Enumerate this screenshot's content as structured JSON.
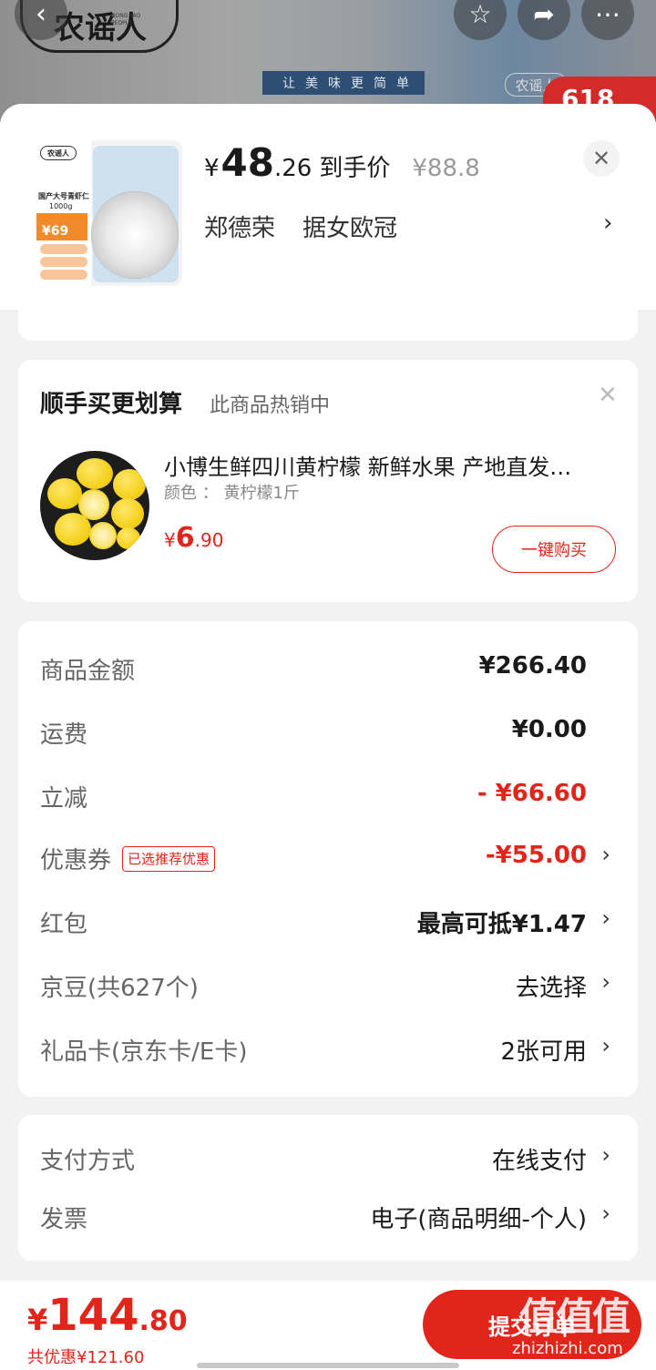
{
  "background": {
    "brand": "农谣人",
    "brand_sub": "NONG YAO PEOPLE",
    "slogan": "让美味更简单",
    "brand_small": "农谣人",
    "badge": "618",
    "icons": [
      "back-icon",
      "star-icon",
      "share-icon",
      "more-icon"
    ]
  },
  "product": {
    "thumb": {
      "brand": "农谣人",
      "title": "国产大号青虾仁",
      "weight": "1000g",
      "promo_price": "¥69"
    },
    "currency": "¥",
    "price_int": "48",
    "price_dec": ".26",
    "price_label": "到手价",
    "original_price": "¥88.8",
    "spec1": "郑德荣",
    "spec2": "据女欧冠",
    "chevron": "›",
    "close": "✕"
  },
  "recommend": {
    "title": "顺手买更划算",
    "subtitle": "此商品热销中",
    "close": "✕",
    "item": {
      "name": "小博生鲜四川黄柠檬  新鲜水果  产地直发…",
      "attr": "颜色 ： 黄柠檬1斤",
      "currency": "¥",
      "price_int": "6",
      "price_dec": ".90",
      "button": "一键购买"
    }
  },
  "summary": {
    "rows": [
      {
        "label": "商品金额",
        "value": "¥266.40"
      },
      {
        "label": "运费",
        "value": "¥0.00"
      },
      {
        "label": "立减",
        "value": "- ¥66.60"
      },
      {
        "label": "优惠券",
        "tag": "已选推荐优惠",
        "value": "-¥55.00"
      },
      {
        "label": "红包",
        "value": "最高可抵¥1.47"
      },
      {
        "label": "京豆(共627个)",
        "value": "去选择"
      },
      {
        "label": "礼品卡(京东卡/E卡)",
        "value": "2张可用"
      }
    ],
    "chevron": "›"
  },
  "payment": {
    "rows": [
      {
        "label": "支付方式",
        "value": "在线支付"
      },
      {
        "label": "发票",
        "value": "电子(商品明细-个人)"
      }
    ]
  },
  "footer": {
    "currency": "¥",
    "total_int": "144",
    "total_dec": ".80",
    "saved": "共优惠¥121.60",
    "submit": "提交订单",
    "watermark_big": "值值值",
    "watermark_small": "zhizhizhi.com"
  },
  "colors": {
    "accent": "#e1251b",
    "background": "#f2f2f2",
    "card": "#ffffff"
  }
}
